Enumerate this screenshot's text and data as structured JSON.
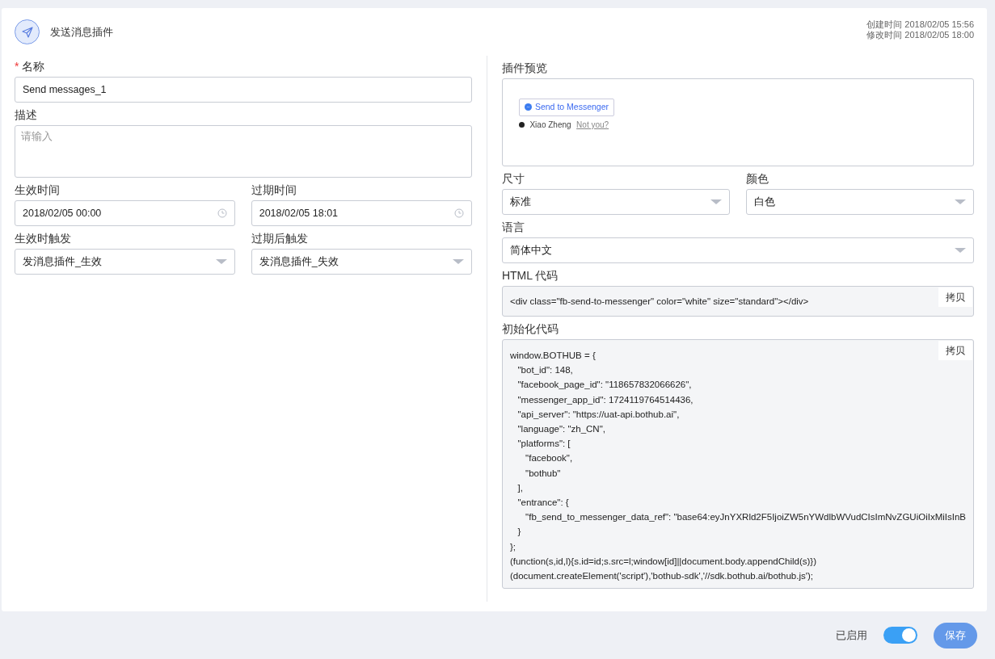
{
  "header": {
    "title": "发送消息插件",
    "created_label": "创建时间",
    "created_value": "2018/02/05 15:56",
    "modified_label": "修改时间",
    "modified_value": "2018/02/05 18:00"
  },
  "left": {
    "name": {
      "label": "名称",
      "required": true,
      "required_mark": "*",
      "value": "Send messages_1"
    },
    "description": {
      "label": "描述",
      "placeholder": "请输入"
    },
    "times": [
      {
        "label": "生效时间",
        "value": "2018/02/05 00:00"
      },
      {
        "label": "过期时间",
        "value": "2018/02/05 18:01"
      }
    ],
    "triggers": [
      {
        "label": "生效时触发",
        "value": "发消息插件_生效"
      },
      {
        "label": "过期后触发",
        "value": "发消息插件_失效"
      }
    ]
  },
  "right": {
    "preview": {
      "label": "插件预览",
      "button_text": "Send to Messenger",
      "user_name": "Xiao Zheng",
      "not_you_link": "Not you?"
    },
    "selects": [
      {
        "label": "尺寸",
        "value": "标准"
      },
      {
        "label": "颜色",
        "value": "白色"
      }
    ],
    "language": {
      "label": "语言",
      "value": "简体中文"
    },
    "html_code": {
      "label": "HTML 代码",
      "code": "<div class=\"fb-send-to-messenger\" color=\"white\" size=\"standard\"></div>",
      "copy_button": "拷贝"
    },
    "init_code": {
      "label": "初始化代码",
      "copy_button": "拷贝",
      "lines": [
        "window.BOTHUB = {",
        "   \"bot_id\": 148,",
        "   \"facebook_page_id\": \"118657832066626\",",
        "   \"messenger_app_id\": 1724119764514436,",
        "   \"api_server\": \"https://uat-api.bothub.ai\",",
        "   \"language\": \"zh_CN\",",
        "   \"platforms\": [",
        "      \"facebook\",",
        "      \"bothub\"",
        "   ],",
        "   \"entrance\": {",
        "      \"fb_send_to_messenger_data_ref\": \"base64:eyJnYXRld2F5IjoiZW5nYWdlbWVudCIsImNvZGUiOiIxMiIsInB",
        "   }",
        "};",
        "(function(s,id,l){s.id=id;s.src=l;window[id]||document.body.appendChild(s)})",
        "(document.createElement('script'),'bothub-sdk','//sdk.bothub.ai/bothub.js');"
      ]
    }
  },
  "footer": {
    "enabled_label": "已启用",
    "enabled": true,
    "save_button": "保存"
  }
}
